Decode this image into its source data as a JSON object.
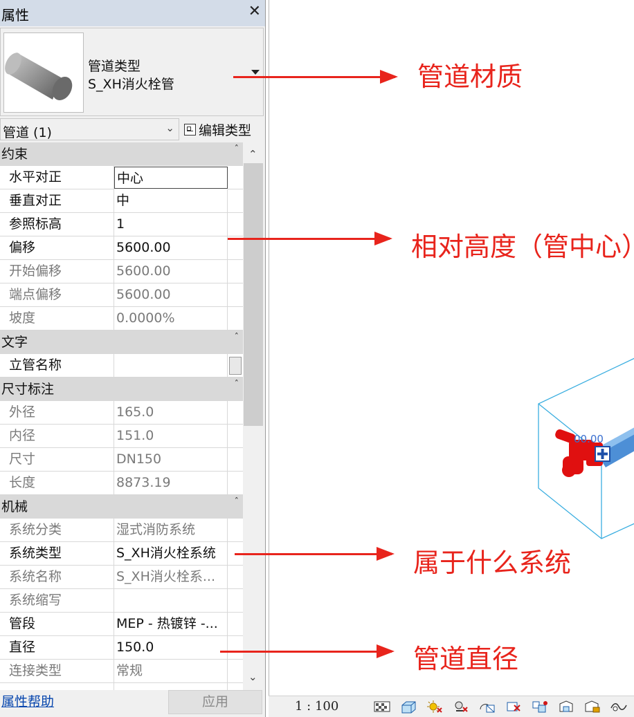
{
  "panel": {
    "title": "属性",
    "close_glyph": "✕",
    "type_line1": "管道类型",
    "type_line2": "S_XH消火栓管",
    "filter_label": "管道 (1)",
    "edit_type_label": "编辑类型",
    "help_link": "属性帮助",
    "apply_label": "应用"
  },
  "groups": {
    "constraints": "约束",
    "text": "文字",
    "dimensions": "尺寸标注",
    "mechanical": "机械"
  },
  "rows": {
    "r0": {
      "name": "水平对正",
      "value": "中心"
    },
    "r1": {
      "name": "垂直对正",
      "value": "中"
    },
    "r2": {
      "name": "参照标高",
      "value": "1"
    },
    "r3": {
      "name": "偏移",
      "value": "5600.00"
    },
    "r4": {
      "name": "开始偏移",
      "value": "5600.00"
    },
    "r5": {
      "name": "端点偏移",
      "value": "5600.00"
    },
    "r6": {
      "name": "坡度",
      "value": "0.0000%"
    },
    "r7": {
      "name": "立管名称",
      "value": ""
    },
    "r8": {
      "name": "外径",
      "value": "165.0"
    },
    "r9": {
      "name": "内径",
      "value": "151.0"
    },
    "r10": {
      "name": "尺寸",
      "value": "DN150"
    },
    "r11": {
      "name": "长度",
      "value": "8873.19"
    },
    "r12": {
      "name": "系统分类",
      "value": "湿式消防系统"
    },
    "r13": {
      "name": "系统类型",
      "value": "S_XH消火栓系统"
    },
    "r14": {
      "name": "系统名称",
      "value": "S_XH消火栓系..."
    },
    "r15": {
      "name": "系统缩写",
      "value": ""
    },
    "r16": {
      "name": "管段",
      "value": "MEP - 热镀锌 -..."
    },
    "r17": {
      "name": "直径",
      "value": "150.0"
    },
    "r18": {
      "name": "连接类型",
      "value": "常规"
    }
  },
  "annotations": {
    "material": "管道材质",
    "height": "相对高度（管中心）",
    "system": "属于什么系统",
    "diameter": "管道直径"
  },
  "viewport": {
    "pipe_label": "00.00"
  },
  "statusbar": {
    "scale": "1 : 100",
    "icons": [
      "detail-level-icon",
      "visual-style-icon",
      "sun-path-icon",
      "shadows-icon",
      "crop-view-icon",
      "show-crop-icon",
      "temporary-hide-icon",
      "reveal-hidden-icon",
      "lock-3d-view-icon",
      "analysis-display-icon",
      "highlight-displacement-icon"
    ]
  },
  "colors": {
    "annotation_red": "#e8241c",
    "pipe_red": "#e01010",
    "pipe_blue": "#4d8fd6",
    "box_line": "#3aaee0",
    "title_bar": "#d3dce8"
  }
}
